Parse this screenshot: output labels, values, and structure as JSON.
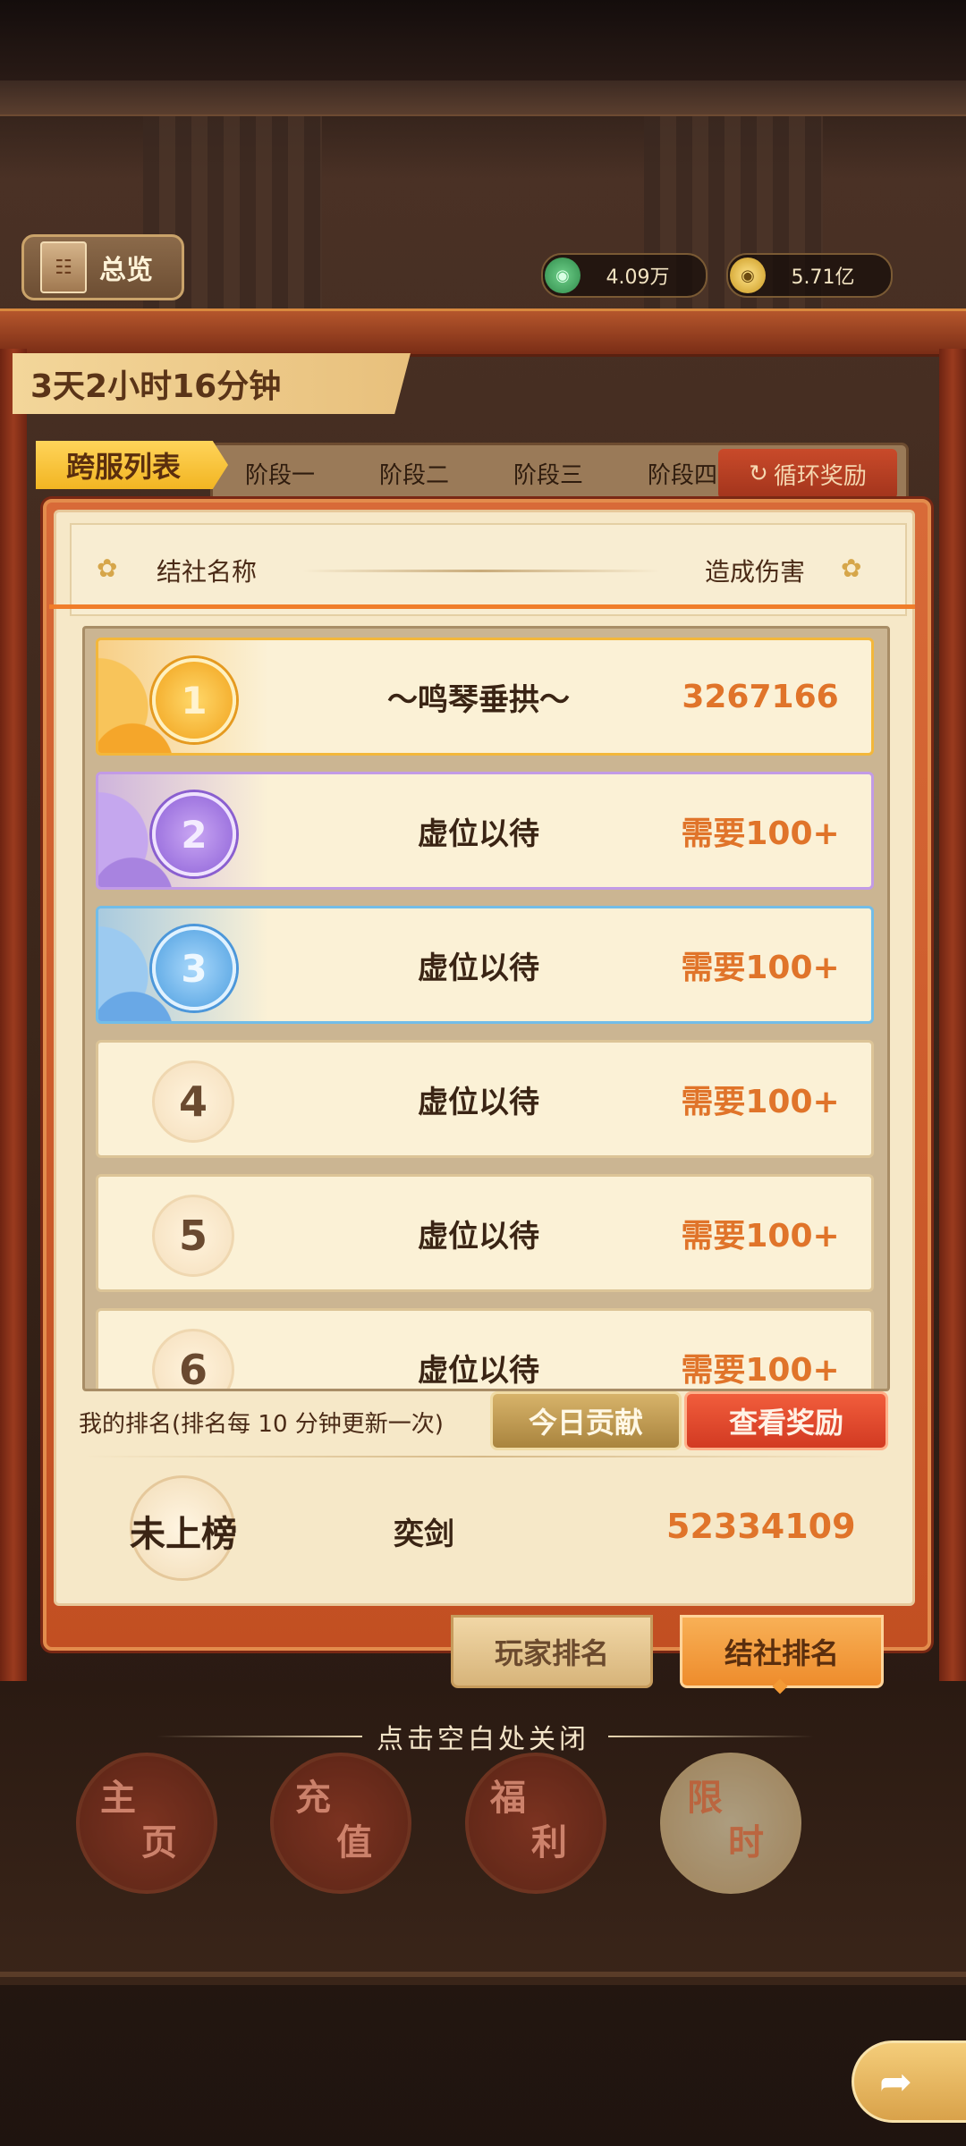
{
  "header": {
    "overview_label": "总览",
    "currency_jade": "4.09万",
    "currency_gold": "5.71亿"
  },
  "timer": "3天2小时16分钟",
  "cross_server_tag": "跨服列表",
  "stage_tabs": [
    "阶段一",
    "阶段二",
    "阶段三",
    "阶段四"
  ],
  "cycle_reward_tab": "循环奖励",
  "table_header": {
    "name_col": "结社名称",
    "damage_col": "造成伤害"
  },
  "rankings": [
    {
      "rank": "1",
      "name": "～鸣琴垂拱～",
      "score": "3267166"
    },
    {
      "rank": "2",
      "name": "虚位以待",
      "score": "需要100+"
    },
    {
      "rank": "3",
      "name": "虚位以待",
      "score": "需要100+"
    },
    {
      "rank": "4",
      "name": "虚位以待",
      "score": "需要100+"
    },
    {
      "rank": "5",
      "name": "虚位以待",
      "score": "需要100+"
    },
    {
      "rank": "6",
      "name": "虚位以待",
      "score": "需要100+"
    }
  ],
  "my_rank": {
    "label": "我的排名(排名每 10 分钟更新一次)",
    "today_contribution_button": "今日贡献",
    "view_rewards_button": "查看奖励",
    "rank_text": "未上榜",
    "name": "奕剑",
    "score": "52334109"
  },
  "bottom_tabs": {
    "player_rank": "玩家排名",
    "guild_rank": "结社排名"
  },
  "close_hint": "点击空白处关闭",
  "nav": [
    {
      "top": "主",
      "bottom": "页"
    },
    {
      "top": "充",
      "bottom": "值"
    },
    {
      "top": "福",
      "bottom": "利"
    },
    {
      "top": "限",
      "bottom": "时"
    }
  ],
  "icons": {
    "overview": "book-icon",
    "currency_jade": "jade-coin-icon",
    "currency_gold": "gold-coin-icon",
    "cycle": "refresh-icon",
    "back": "back-arrow-icon"
  },
  "colors": {
    "accent_orange": "#e0742a",
    "panel_red": "#c24f22",
    "gold": "#f2b522"
  }
}
